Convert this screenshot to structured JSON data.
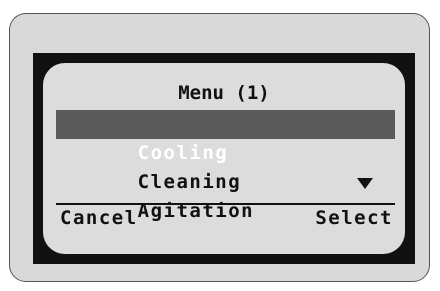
{
  "menu": {
    "title": "Menu (1)",
    "items": [
      {
        "label": "Cooling",
        "selected": true
      },
      {
        "label": "Cleaning",
        "selected": false
      },
      {
        "label": "Agitation",
        "selected": false
      }
    ],
    "scroll_indicator_icon": "down-triangle-icon"
  },
  "softkeys": {
    "left_label": "Cancel",
    "right_label": "Select"
  },
  "colors": {
    "screen_background": "#dcdcdc",
    "selection_highlight": "#5a5a5a",
    "bezel": "#111111",
    "device_body": "#d9d9d9"
  }
}
